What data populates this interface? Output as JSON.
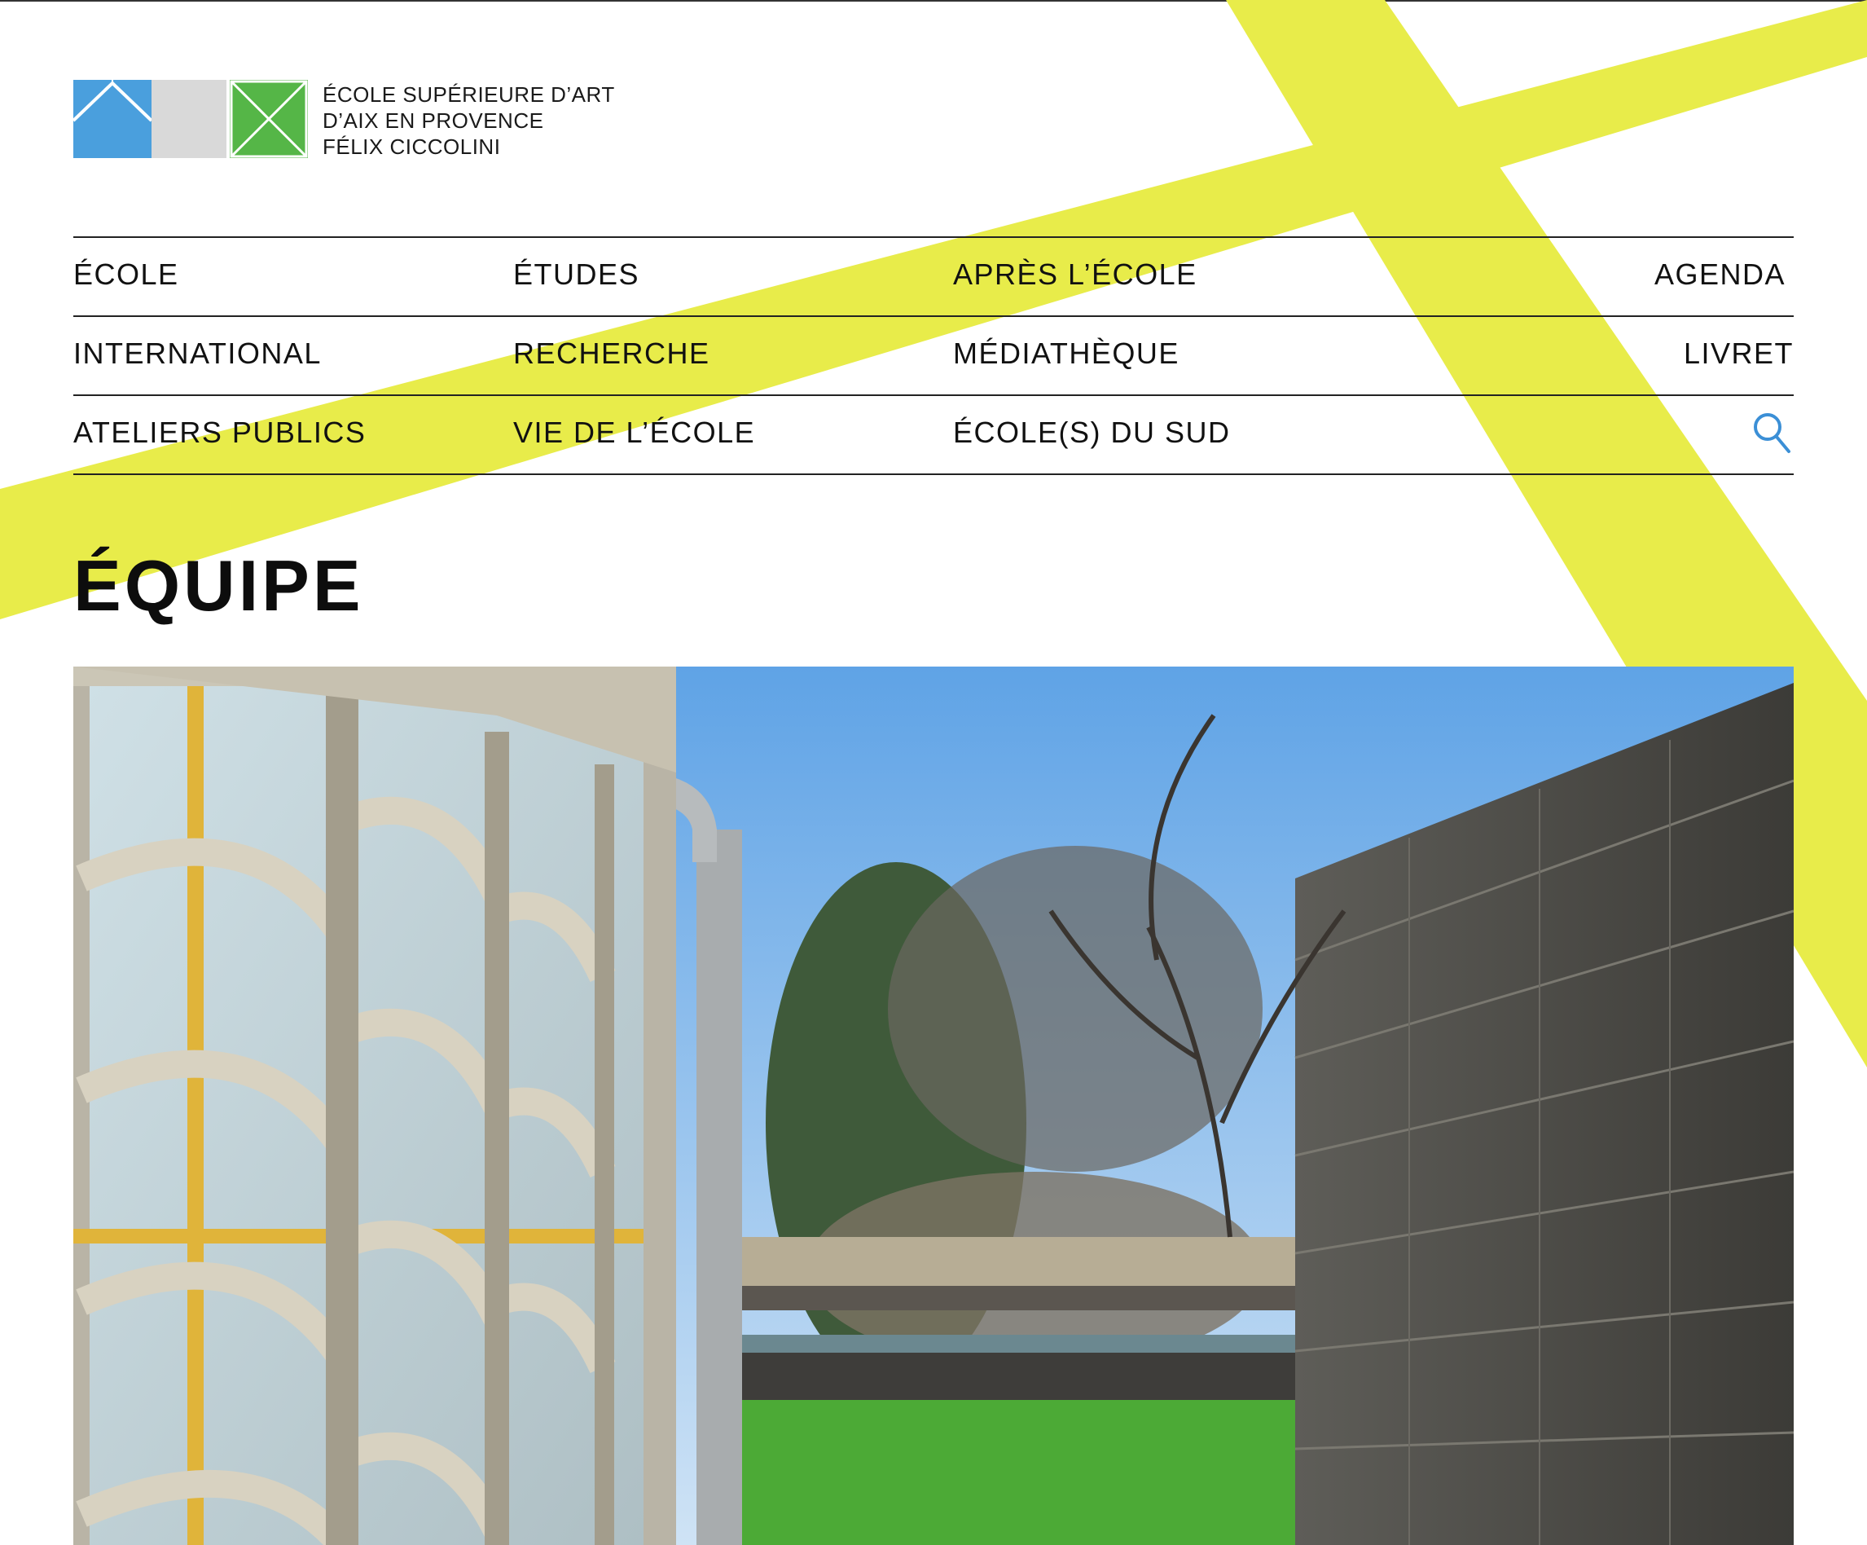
{
  "site": {
    "logo": {
      "line1": "ÉCOLE SUPÉRIEURE D’ART",
      "line2": "D’AIX EN PROVENCE",
      "line3": "FÉLIX CICCOLINI",
      "colors": {
        "blue": "#4a9fdd",
        "grey": "#d9d9d9",
        "green": "#55b647"
      }
    },
    "accent_color": "#e8ec4a"
  },
  "nav": {
    "rows": [
      [
        "ÉCOLE",
        "ÉTUDES",
        "APRÈS L’ÉCOLE",
        "AGENDA"
      ],
      [
        "INTERNATIONAL",
        "RECHERCHE",
        "MÉDIATHÈQUE",
        "LIVRET"
      ],
      [
        "ATELIERS PUBLICS",
        "VIE DE L’ÉCOLE",
        "ÉCOLE(S) DU SUD"
      ]
    ],
    "search_icon": "search-icon",
    "search_color": "#3b8fd6"
  },
  "page": {
    "title": "ÉQUIPE"
  },
  "hero": {
    "icon": "building-photo"
  }
}
